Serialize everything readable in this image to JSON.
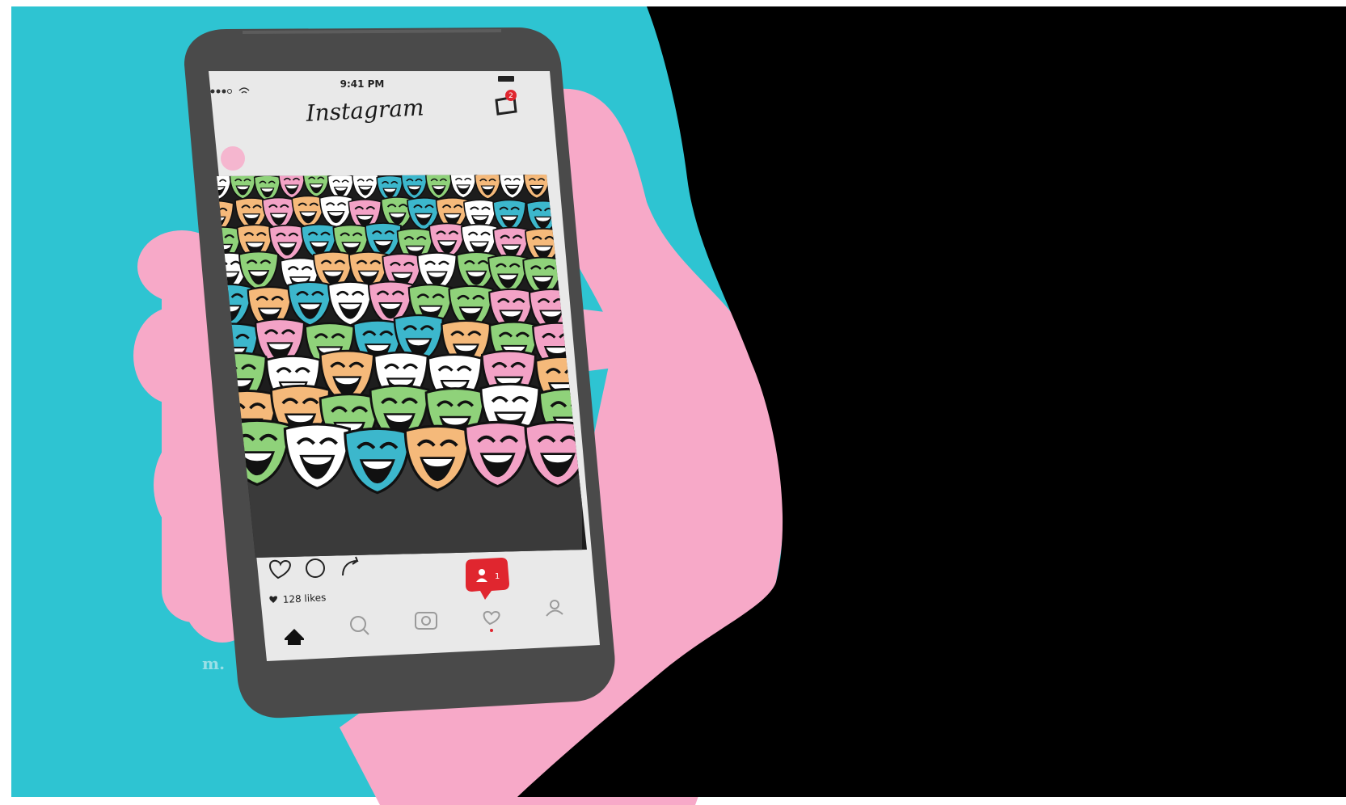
{
  "status_bar": {
    "time": "9:41 PM",
    "signal_icon": "signal-dots-icon",
    "wifi_icon": "wifi-icon",
    "battery_icon": "battery-icon"
  },
  "header": {
    "app_title": "Instagram",
    "inbox_icon": "inbox-icon",
    "inbox_badge": "2"
  },
  "post": {
    "image_subject": "crowd holding smiling theatre masks",
    "actions": [
      "heart-icon",
      "comment-icon",
      "share-icon"
    ],
    "likes_text": "128 likes",
    "notification": {
      "icon": "person-icon",
      "count": "1"
    }
  },
  "bottom_nav": [
    "home-icon",
    "search-icon",
    "camera-icon",
    "heart-icon",
    "profile-icon"
  ],
  "watermark": "m.",
  "colors": {
    "background": "#2ec4d2",
    "hand": "#f7a9c8",
    "phone_body": "#4a4a4a",
    "screen": "#e9e9e9",
    "notification": "#e0262f",
    "dark_area": "#000000",
    "mask_colors": [
      "#ffffff",
      "#f5b97a",
      "#8fd27a",
      "#f3a2c6",
      "#3cb7cc"
    ]
  }
}
